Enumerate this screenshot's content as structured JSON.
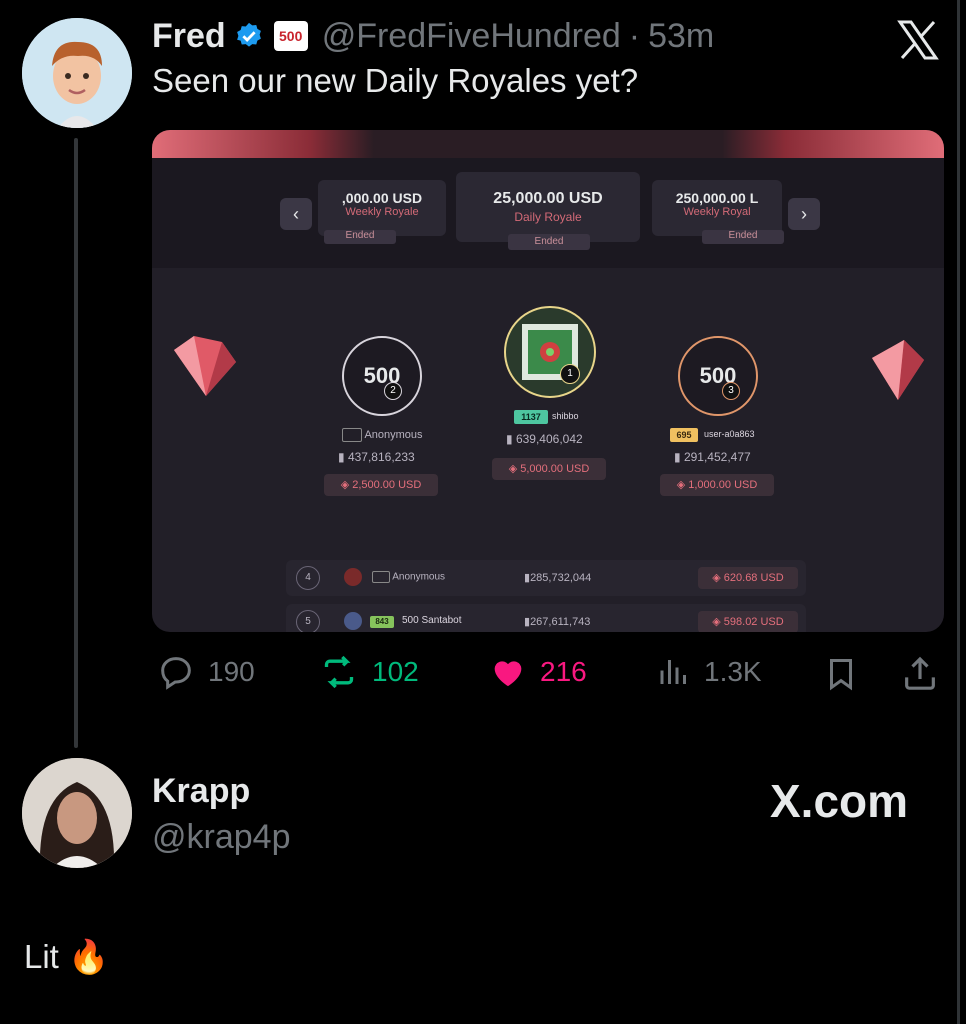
{
  "tweet": {
    "name": "Fred",
    "handle": "@FredFiveHundred",
    "separator": "·",
    "time": "53m",
    "text": "Seen our new Daily Royales yet?",
    "badge_text": "500"
  },
  "media": {
    "cards": [
      {
        "amount": ",000.00 USD",
        "label": "Weekly Royale",
        "status": "Ended"
      },
      {
        "amount": "25,000.00 USD",
        "label": "Daily Royale",
        "status": "Ended"
      },
      {
        "amount": "250,000.00 L",
        "label": "Weekly Royal",
        "status": "Ended"
      }
    ],
    "prev_arrow": "‹",
    "next_arrow": "›",
    "podium": [
      {
        "logo": "500",
        "rank": "2",
        "user": "Anonymous",
        "score": "437,816,233",
        "prize": "2,500.00 USD"
      },
      {
        "rank": "1",
        "level": "1137",
        "user": "shibbo",
        "score": "639,406,042",
        "prize": "5,000.00 USD"
      },
      {
        "logo": "500",
        "rank": "3",
        "level": "695",
        "user": "user-a0a863",
        "score": "291,452,477",
        "prize": "1,000.00 USD"
      }
    ],
    "rows": [
      {
        "rank": "4",
        "user": "Anonymous",
        "score": "285,732,044",
        "prize": "620.68 USD"
      },
      {
        "rank": "5",
        "level": "843",
        "user": "500 Santabot",
        "score": "267,611,743",
        "prize": "598.02 USD"
      }
    ]
  },
  "actions": {
    "replies": "190",
    "retweets": "102",
    "likes": "216",
    "views": "1.3K"
  },
  "reply": {
    "name": "Krapp",
    "handle": "@krap4p",
    "text": "Lit 🔥"
  },
  "watermark": "X.com",
  "x_logo": "X",
  "colors": {
    "retweet": "#00ba7c",
    "like": "#f91880",
    "verified": "#1d9bf0",
    "muted": "#71767b"
  }
}
